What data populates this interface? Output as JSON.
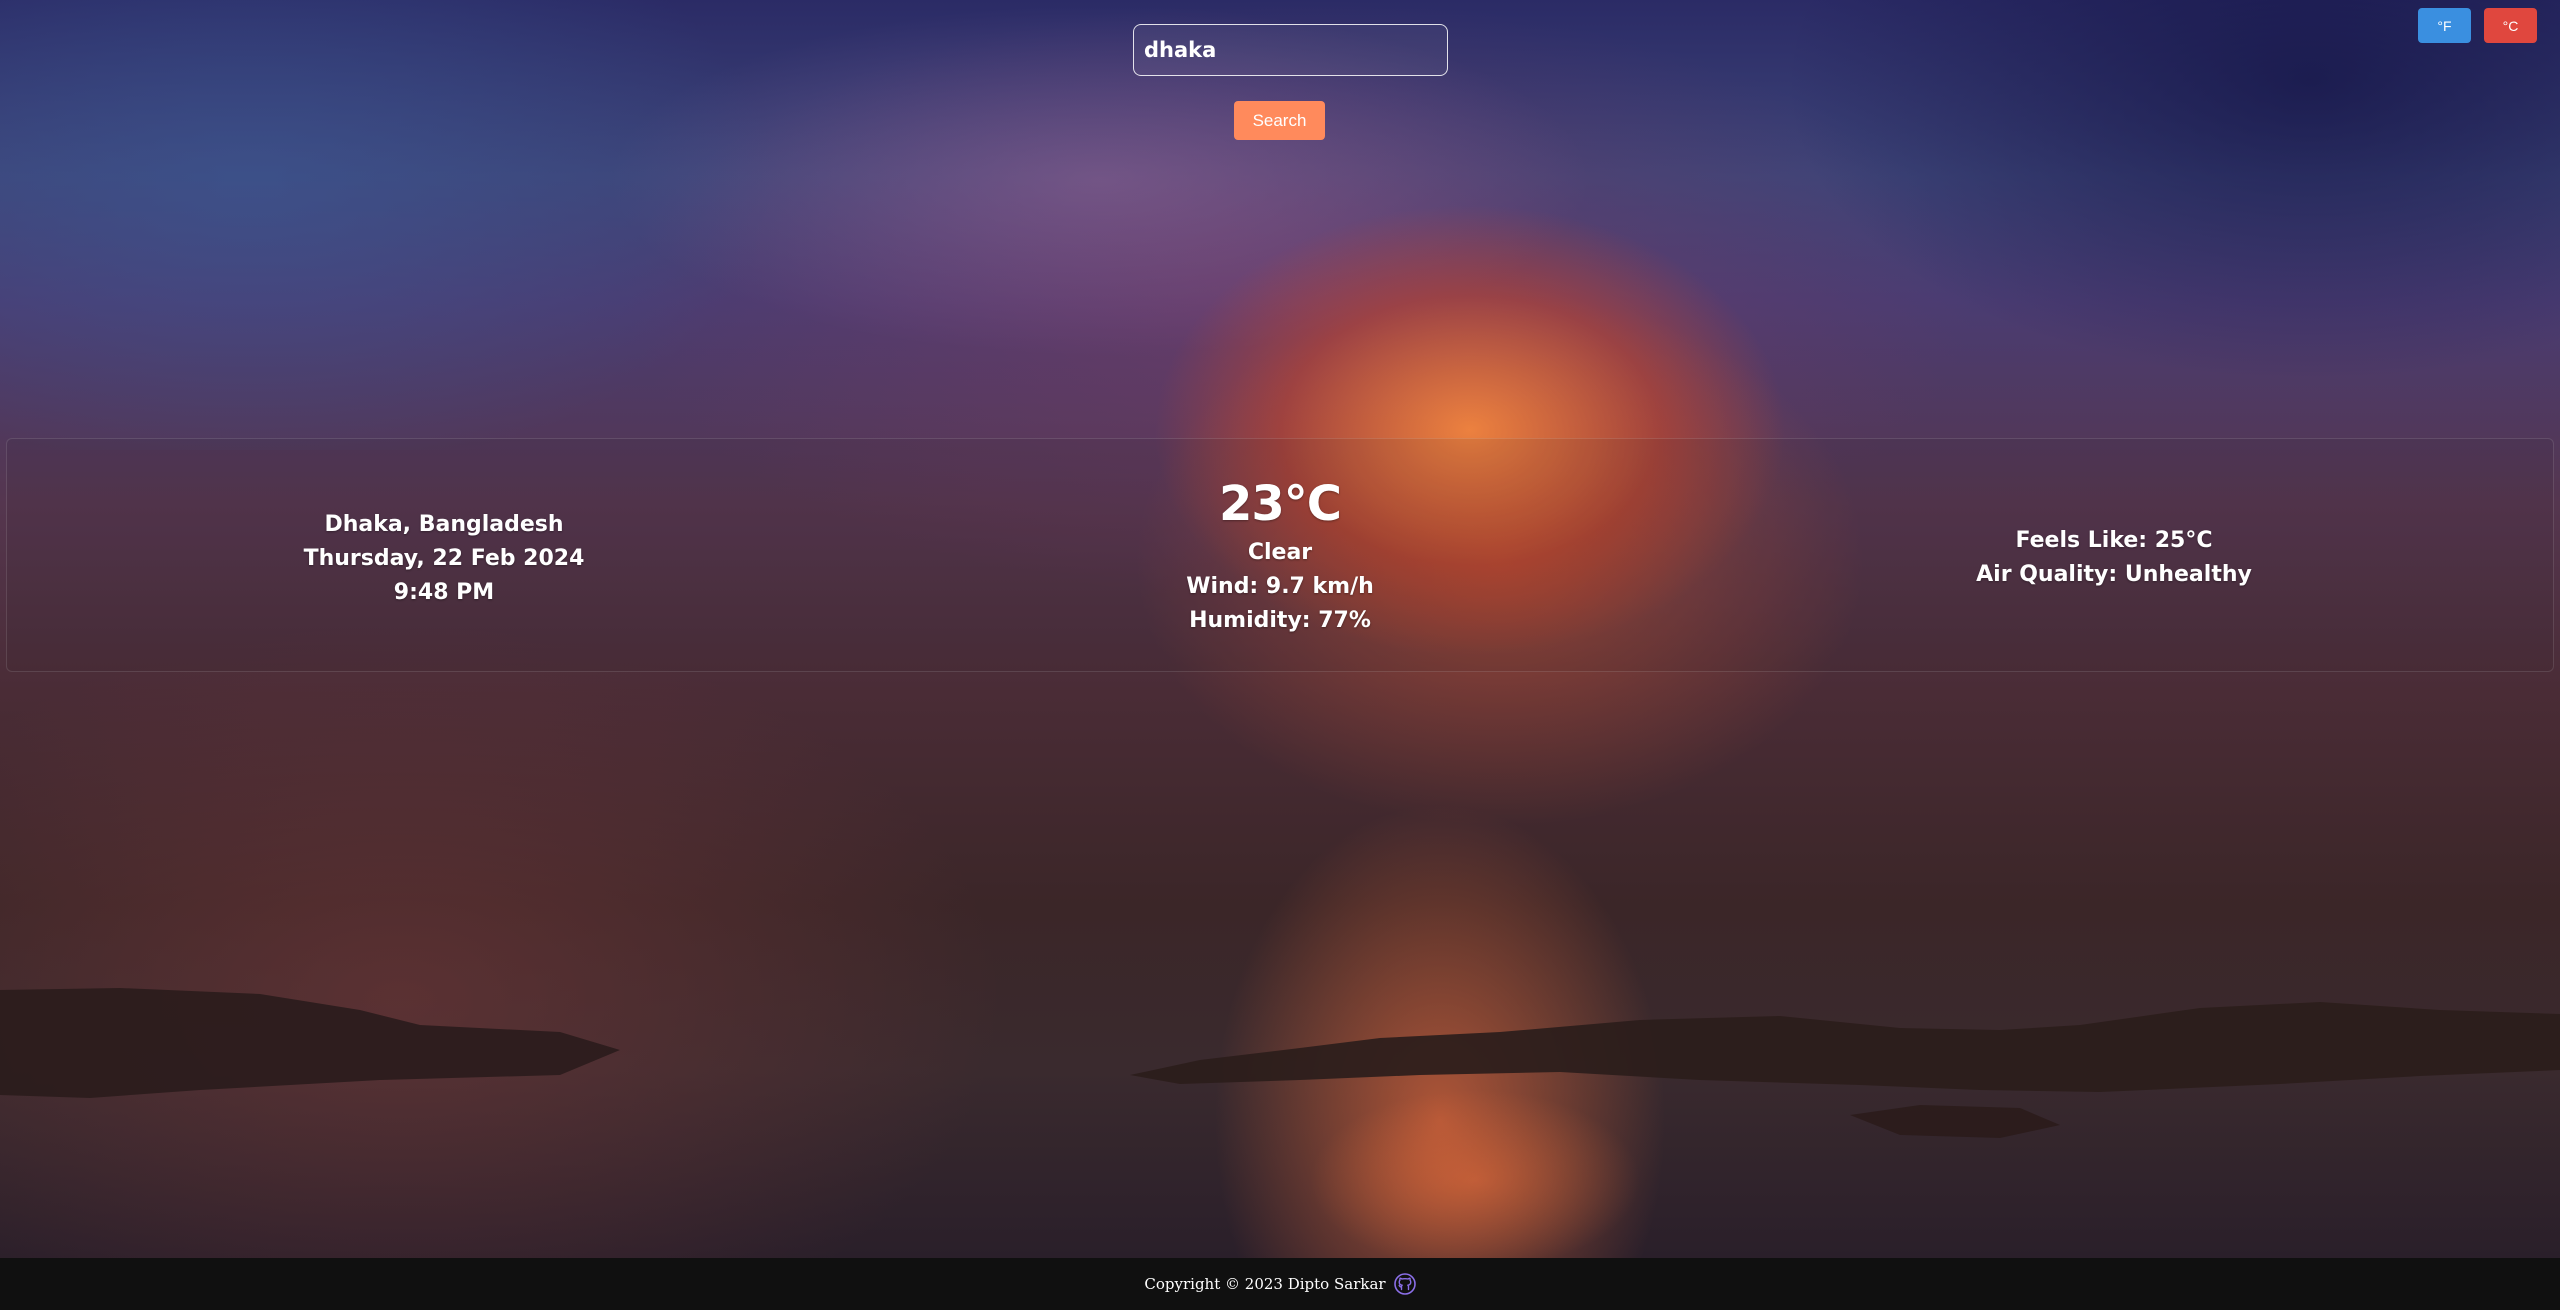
{
  "units": {
    "fahrenheit_label": "°F",
    "celsius_label": "°C",
    "active": "°C"
  },
  "search": {
    "value": "dhaka",
    "button_label": "Search"
  },
  "location": {
    "place": "Dhaka, Bangladesh",
    "date": "Thursday, 22 Feb 2024",
    "time": "9:48 PM"
  },
  "current": {
    "temperature": "23°C",
    "condition": "Clear",
    "wind": "Wind: 9.7 km/h",
    "humidity": "Humidity: 77%"
  },
  "details": {
    "feels_like": "Feels Like: 25°C",
    "air_quality": "Air Quality: Unhealthy"
  },
  "footer": {
    "copyright": "Copyright © 2023 Dipto Sarkar",
    "icon": "github-icon"
  },
  "colors": {
    "fahrenheit_button": "#3a8fe0",
    "celsius_button": "#e0473e",
    "search_button": "#ff8a5c",
    "footer_bg": "#101010"
  }
}
